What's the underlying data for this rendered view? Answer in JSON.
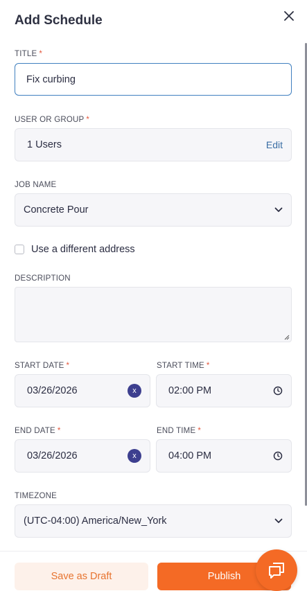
{
  "header": {
    "title": "Add Schedule"
  },
  "form": {
    "title": {
      "label": "TITLE",
      "required_mark": "*",
      "value": "Fix curbing"
    },
    "user_group": {
      "label": "USER OR GROUP",
      "required_mark": "*",
      "value": "1 Users",
      "edit_label": "Edit"
    },
    "job_name": {
      "label": "JOB NAME",
      "value": "Concrete Pour"
    },
    "different_address": {
      "label": "Use a different address",
      "checked": false
    },
    "description": {
      "label": "DESCRIPTION",
      "value": ""
    },
    "start_date": {
      "label": "START DATE",
      "required_mark": "*",
      "value": "03/26/2026",
      "clear_label": "x"
    },
    "start_time": {
      "label": "START TIME",
      "required_mark": "*",
      "value": "02:00 PM"
    },
    "end_date": {
      "label": "END DATE",
      "required_mark": "*",
      "value": "03/26/2026",
      "clear_label": "x"
    },
    "end_time": {
      "label": "END TIME",
      "required_mark": "*",
      "value": "04:00 PM"
    },
    "timezone": {
      "label": "TIMEZONE",
      "value": "(UTC-04:00) America/New_York"
    }
  },
  "footer": {
    "draft_label": "Save as Draft",
    "publish_label": "Publish"
  },
  "colors": {
    "accent": "#f46a25",
    "draft_bg": "#fdf1ea",
    "badge": "#3d3f8f",
    "required": "#e4573d",
    "focus_border": "#3f7fbf"
  },
  "icons": {
    "close": "close-icon",
    "chevron": "chevron-down-icon",
    "clock": "clock-icon",
    "chat": "chat-icon"
  }
}
